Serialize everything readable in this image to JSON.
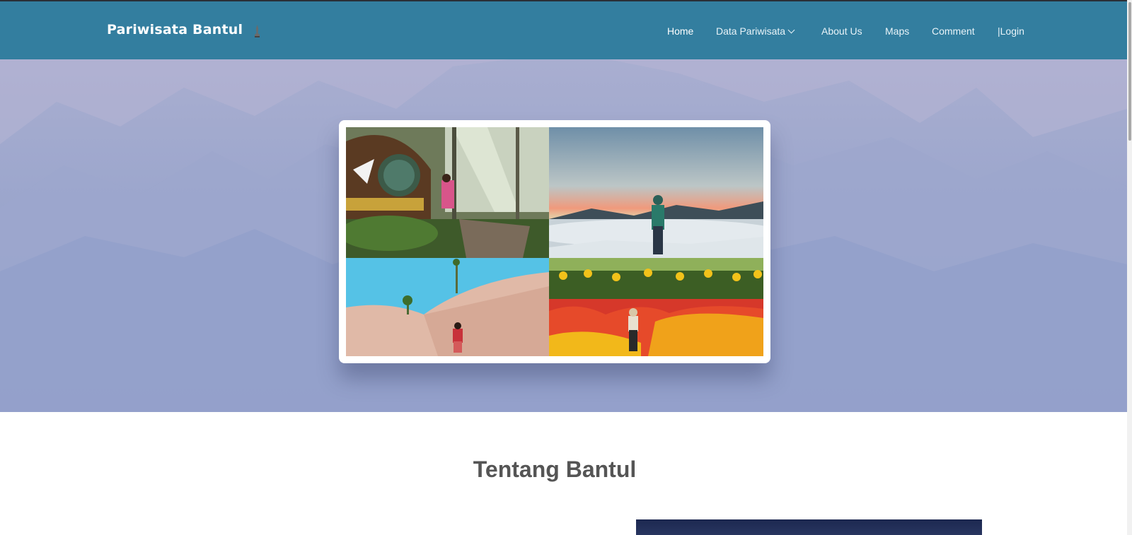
{
  "navbar": {
    "brand": "Pariwisata Bantul",
    "brand_logo_text": "Jogja",
    "items": [
      {
        "label": "Home",
        "active": true
      },
      {
        "label": "Data Pariwisata",
        "has_dropdown": true
      },
      {
        "label": "About Us"
      },
      {
        "label": "Maps"
      },
      {
        "label": "Comment"
      },
      {
        "label": "|Login"
      }
    ]
  },
  "hero": {
    "collage_images": [
      "hobbit-house-forest",
      "misty-mountain-sunrise",
      "sand-dunes-beach",
      "flower-garden"
    ]
  },
  "about": {
    "title": "Tentang Bantul"
  },
  "colors": {
    "navbar": "#337e9f",
    "hero_bg": "#9aa5cc",
    "title_text": "#555555"
  }
}
